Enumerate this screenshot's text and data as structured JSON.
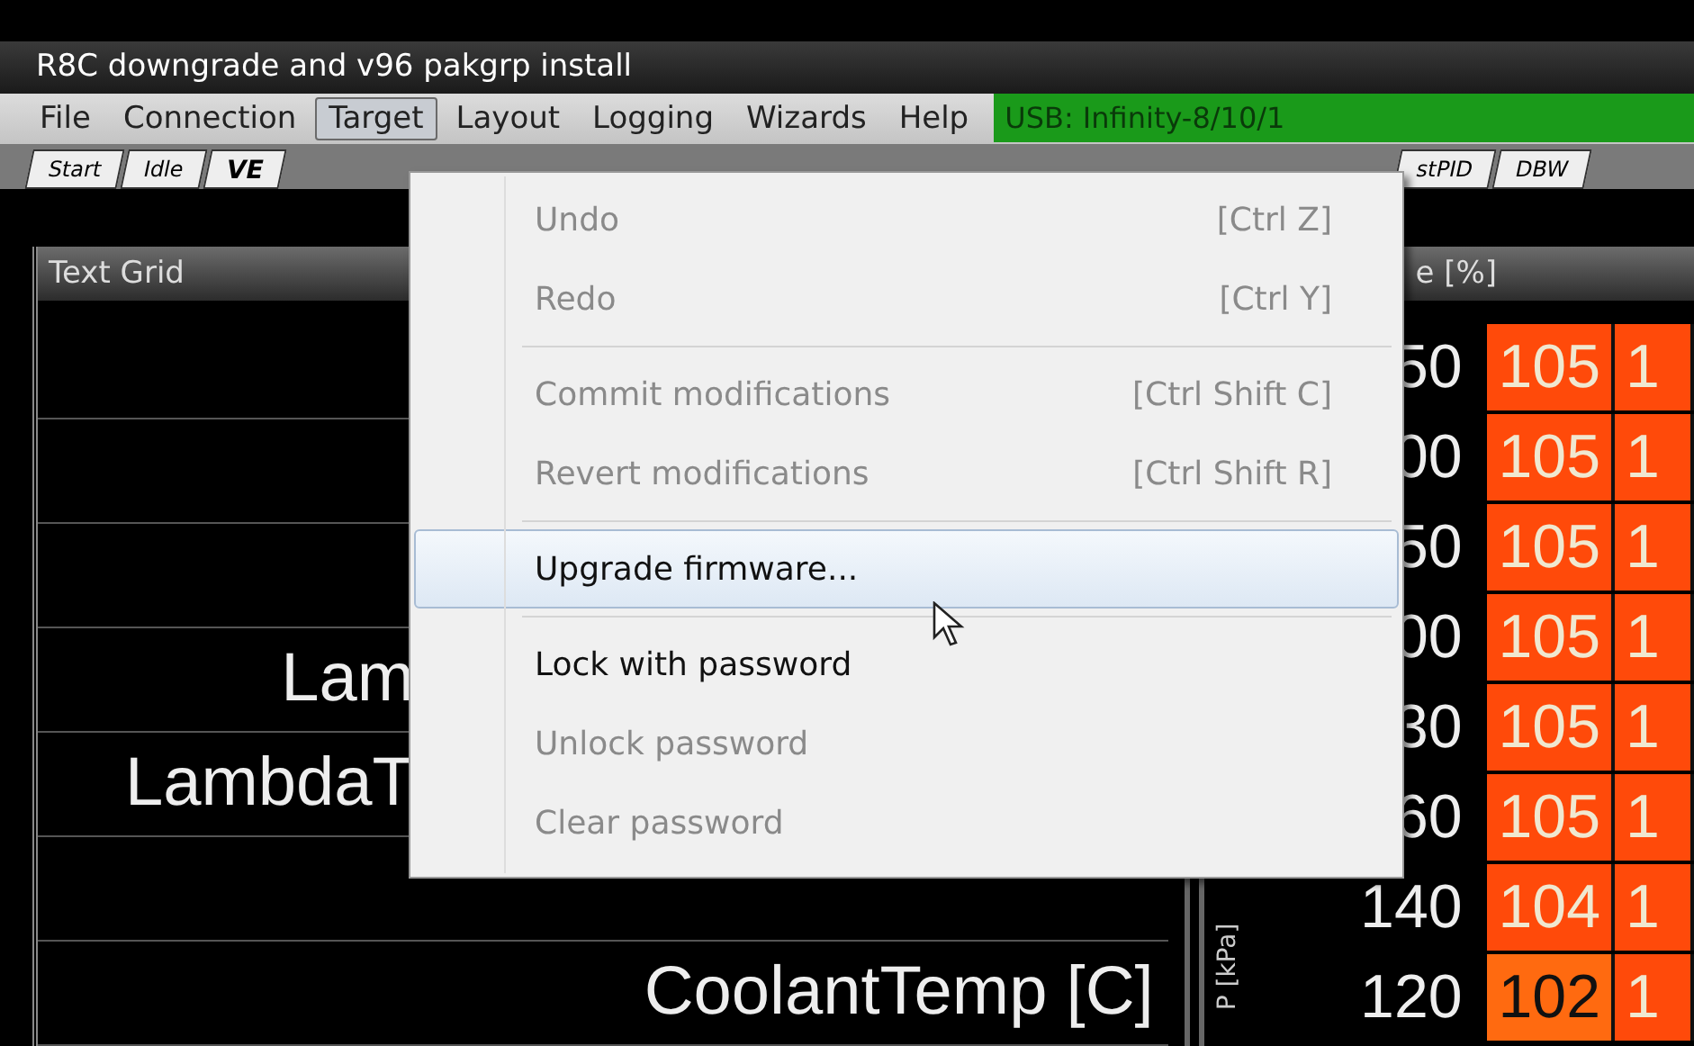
{
  "window": {
    "title": "R8C downgrade and v96 pakgrp install"
  },
  "menubar": [
    {
      "label": "File",
      "selected": false
    },
    {
      "label": "Connection",
      "selected": false
    },
    {
      "label": "Target",
      "selected": true
    },
    {
      "label": "Layout",
      "selected": false
    },
    {
      "label": "Logging",
      "selected": false
    },
    {
      "label": "Wizards",
      "selected": false
    },
    {
      "label": "Help",
      "selected": false
    }
  ],
  "connection_status": "USB: Infinity-8/10/1",
  "tabs_left": [
    {
      "label": "Start",
      "selected": false
    },
    {
      "label": "Idle",
      "selected": false
    },
    {
      "label": "VE",
      "selected": true
    }
  ],
  "tabs_right": [
    {
      "label": "stPID",
      "selected": false
    },
    {
      "label": "DBW",
      "selected": false
    }
  ],
  "text_grid": {
    "title": "Text Grid",
    "rows": [
      {
        "kind": "empty"
      },
      {
        "kind": "empty"
      },
      {
        "kind": "empty"
      },
      {
        "kind": "covered",
        "text": "Lam"
      },
      {
        "kind": "covered",
        "text": "LambdaT"
      },
      {
        "kind": "empty"
      },
      {
        "kind": "full",
        "text": "CoolantTemp [C]"
      }
    ]
  },
  "table": {
    "title": "e [%]",
    "axis_label": "P [kPa]",
    "rows": [
      {
        "label": "50",
        "cells": [
          "105",
          "1"
        ]
      },
      {
        "label": "00",
        "cells": [
          "105",
          "1"
        ]
      },
      {
        "label": "50",
        "cells": [
          "105",
          "1"
        ]
      },
      {
        "label": "00",
        "cells": [
          "105",
          "1"
        ]
      },
      {
        "label": "30",
        "cells": [
          "105",
          "1"
        ]
      },
      {
        "label": "60",
        "cells": [
          "105",
          "1"
        ]
      },
      {
        "label": "140",
        "cells": [
          "104",
          "1"
        ]
      },
      {
        "label": "120",
        "cells": [
          "102",
          "1"
        ]
      }
    ]
  },
  "dropdown": [
    {
      "kind": "item",
      "label": "Undo",
      "shortcut": "[Ctrl Z]",
      "disabled": true,
      "highlighted": false
    },
    {
      "kind": "item",
      "label": "Redo",
      "shortcut": "[Ctrl Y]",
      "disabled": true,
      "highlighted": false
    },
    {
      "kind": "separator"
    },
    {
      "kind": "item",
      "label": "Commit modifications",
      "shortcut": "[Ctrl Shift C]",
      "disabled": true,
      "highlighted": false
    },
    {
      "kind": "item",
      "label": "Revert modifications",
      "shortcut": "[Ctrl Shift R]",
      "disabled": true,
      "highlighted": false
    },
    {
      "kind": "separator"
    },
    {
      "kind": "item",
      "label": "Upgrade firmware...",
      "disabled": false,
      "highlighted": true
    },
    {
      "kind": "separator"
    },
    {
      "kind": "item",
      "label": "Lock with password",
      "disabled": false,
      "highlighted": false
    },
    {
      "kind": "item",
      "label": "Unlock password",
      "disabled": true,
      "highlighted": false
    },
    {
      "kind": "item",
      "label": "Clear password",
      "disabled": true,
      "highlighted": false
    }
  ]
}
